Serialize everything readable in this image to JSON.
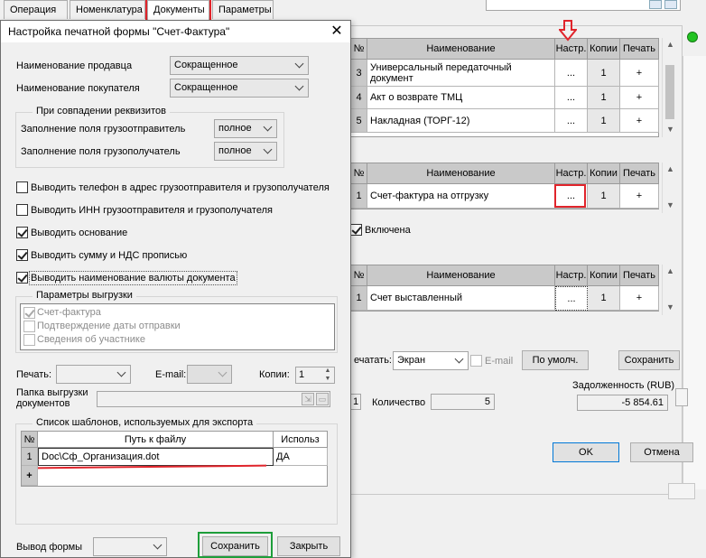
{
  "tabs": [
    {
      "label": "Операция"
    },
    {
      "label": "Номенклатура"
    },
    {
      "label": "Документы"
    },
    {
      "label": "Параметры"
    }
  ],
  "right": {
    "table1": {
      "headers": [
        "№",
        "Наименование",
        "Настр.",
        "Копии",
        "Печать"
      ],
      "rows": [
        {
          "n": "3",
          "name": "Универсальный передаточный документ",
          "settings": "...",
          "copies": "1",
          "print": "+"
        },
        {
          "n": "4",
          "name": "Акт о возврате ТМЦ",
          "settings": "...",
          "copies": "1",
          "print": "+"
        },
        {
          "n": "5",
          "name": "Накладная (ТОРГ-12)",
          "settings": "...",
          "copies": "1",
          "print": "+"
        }
      ]
    },
    "table2": {
      "headers": [
        "№",
        "Наименование",
        "Настр.",
        "Копии",
        "Печать"
      ],
      "rows": [
        {
          "n": "1",
          "name": "Счет-фактура на отгрузку",
          "settings": "...",
          "copies": "1",
          "print": "+"
        }
      ]
    },
    "enabled_label": "Включена",
    "table3": {
      "headers": [
        "№",
        "Наименование",
        "Настр.",
        "Копии",
        "Печать"
      ],
      "rows": [
        {
          "n": "1",
          "name": "Счет выставленный",
          "settings": "...",
          "copies": "1",
          "print": "+"
        }
      ]
    },
    "print_label": "ечатать:",
    "print_value": "Экран",
    "email_label": "E-mail",
    "default_button": "По умолч.",
    "save_button": "Сохранить",
    "debt_label": "Задолженность (RUB)",
    "debt_value": "-5 854.61",
    "qty_prefix": "1",
    "qty_label": "Количество",
    "qty_value": "5",
    "ok_button": "OK",
    "cancel_button": "Отмена"
  },
  "dialog": {
    "title": "Настройка печатной формы \"Счет-Фактура\"",
    "seller_label": "Наименование продавца",
    "seller_value": "Сокращенное",
    "buyer_label": "Наименование покупателя",
    "buyer_value": "Сокращенное",
    "match_group": "При совпадении реквизитов",
    "consignor_label": "Заполнение поля грузоотправитель",
    "consignor_value": "полное",
    "consignee_label": "Заполнение поля грузополучатель",
    "consignee_value": "полное",
    "checks": [
      {
        "label": "Выводить телефон в адрес грузоотправителя и  грузополучателя",
        "checked": false
      },
      {
        "label": "Выводить ИНН грузоотправителя и грузополучателя",
        "checked": false
      },
      {
        "label": "Выводить основание",
        "checked": true
      },
      {
        "label": "Выводить сумму и НДС прописью",
        "checked": true
      },
      {
        "label": "Выводить наименование валюты документа",
        "checked": true
      }
    ],
    "export_group": "Параметры выгрузки",
    "export_items": [
      {
        "label": "Счет-фактура",
        "checked": true
      },
      {
        "label": "Подтверждение даты отправки",
        "checked": false
      },
      {
        "label": "Сведения об участнике",
        "checked": false
      }
    ],
    "print_label": "Печать:",
    "email_label": "E-mail:",
    "copies_label": "Копии:",
    "copies_value": "1",
    "folder_label_1": "Папка выгрузки",
    "folder_label_2": "документов",
    "templates_group": "Список шаблонов, используемых для экспорта",
    "templates_headers": [
      "№",
      "Путь к файлу",
      "Использ"
    ],
    "templates_rows": [
      {
        "n": "1",
        "path": "Doc\\Сф_Организация.dot",
        "use": "ДА"
      }
    ],
    "add_row": "+",
    "output_label": "Вывод формы",
    "save_button": "Сохранить",
    "close_button": "Закрыть"
  },
  "colors": {
    "highlight_red": "#e0242b",
    "highlight_green": "#1e9e3a",
    "status_green": "#22c322"
  }
}
